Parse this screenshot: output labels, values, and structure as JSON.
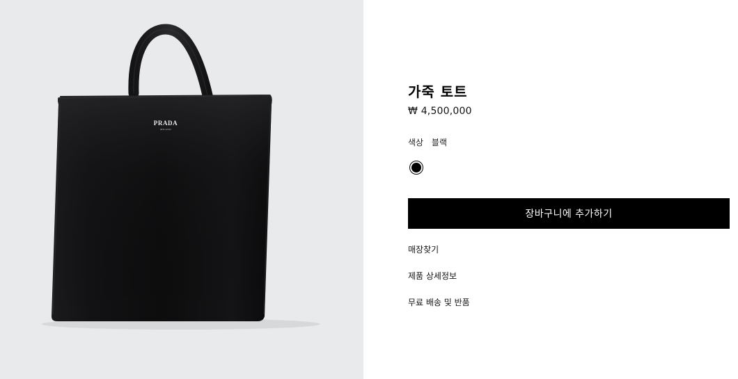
{
  "product": {
    "title": "가죽 토트",
    "price": "₩ 4,500,000",
    "color_label": "색상",
    "color_value": "블랙",
    "swatch_color": "#000000",
    "brand_logo_text": "PRADA",
    "brand_logo_subtext": "MILANO"
  },
  "actions": {
    "add_to_cart_label": "장바구니에 추가하기"
  },
  "links": {
    "store_locator": "매장찾기",
    "product_details": "제품 상세정보",
    "shipping_returns": "무료 배송 및 반품"
  },
  "colors": {
    "image_background": "#e9eaec",
    "bag": "#111111",
    "button_background": "#000000",
    "button_text": "#ffffff"
  }
}
